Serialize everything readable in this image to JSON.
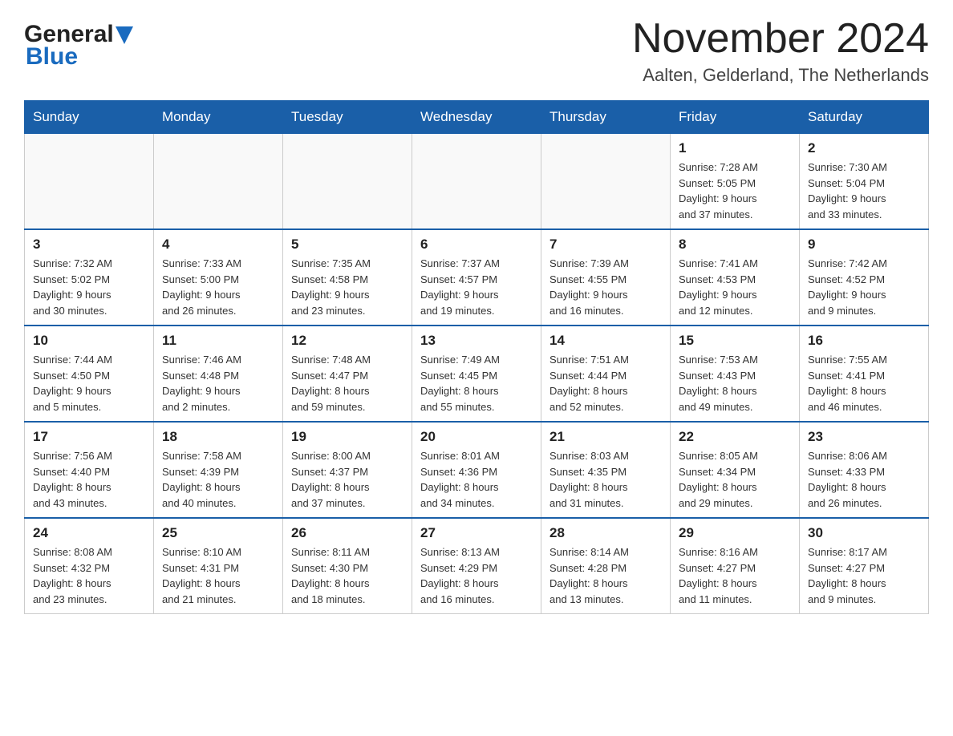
{
  "logo": {
    "part1": "General",
    "part2": "Blue"
  },
  "title": "November 2024",
  "subtitle": "Aalten, Gelderland, The Netherlands",
  "days_of_week": [
    "Sunday",
    "Monday",
    "Tuesday",
    "Wednesday",
    "Thursday",
    "Friday",
    "Saturday"
  ],
  "weeks": [
    [
      {
        "day": "",
        "info": ""
      },
      {
        "day": "",
        "info": ""
      },
      {
        "day": "",
        "info": ""
      },
      {
        "day": "",
        "info": ""
      },
      {
        "day": "",
        "info": ""
      },
      {
        "day": "1",
        "info": "Sunrise: 7:28 AM\nSunset: 5:05 PM\nDaylight: 9 hours\nand 37 minutes."
      },
      {
        "day": "2",
        "info": "Sunrise: 7:30 AM\nSunset: 5:04 PM\nDaylight: 9 hours\nand 33 minutes."
      }
    ],
    [
      {
        "day": "3",
        "info": "Sunrise: 7:32 AM\nSunset: 5:02 PM\nDaylight: 9 hours\nand 30 minutes."
      },
      {
        "day": "4",
        "info": "Sunrise: 7:33 AM\nSunset: 5:00 PM\nDaylight: 9 hours\nand 26 minutes."
      },
      {
        "day": "5",
        "info": "Sunrise: 7:35 AM\nSunset: 4:58 PM\nDaylight: 9 hours\nand 23 minutes."
      },
      {
        "day": "6",
        "info": "Sunrise: 7:37 AM\nSunset: 4:57 PM\nDaylight: 9 hours\nand 19 minutes."
      },
      {
        "day": "7",
        "info": "Sunrise: 7:39 AM\nSunset: 4:55 PM\nDaylight: 9 hours\nand 16 minutes."
      },
      {
        "day": "8",
        "info": "Sunrise: 7:41 AM\nSunset: 4:53 PM\nDaylight: 9 hours\nand 12 minutes."
      },
      {
        "day": "9",
        "info": "Sunrise: 7:42 AM\nSunset: 4:52 PM\nDaylight: 9 hours\nand 9 minutes."
      }
    ],
    [
      {
        "day": "10",
        "info": "Sunrise: 7:44 AM\nSunset: 4:50 PM\nDaylight: 9 hours\nand 5 minutes."
      },
      {
        "day": "11",
        "info": "Sunrise: 7:46 AM\nSunset: 4:48 PM\nDaylight: 9 hours\nand 2 minutes."
      },
      {
        "day": "12",
        "info": "Sunrise: 7:48 AM\nSunset: 4:47 PM\nDaylight: 8 hours\nand 59 minutes."
      },
      {
        "day": "13",
        "info": "Sunrise: 7:49 AM\nSunset: 4:45 PM\nDaylight: 8 hours\nand 55 minutes."
      },
      {
        "day": "14",
        "info": "Sunrise: 7:51 AM\nSunset: 4:44 PM\nDaylight: 8 hours\nand 52 minutes."
      },
      {
        "day": "15",
        "info": "Sunrise: 7:53 AM\nSunset: 4:43 PM\nDaylight: 8 hours\nand 49 minutes."
      },
      {
        "day": "16",
        "info": "Sunrise: 7:55 AM\nSunset: 4:41 PM\nDaylight: 8 hours\nand 46 minutes."
      }
    ],
    [
      {
        "day": "17",
        "info": "Sunrise: 7:56 AM\nSunset: 4:40 PM\nDaylight: 8 hours\nand 43 minutes."
      },
      {
        "day": "18",
        "info": "Sunrise: 7:58 AM\nSunset: 4:39 PM\nDaylight: 8 hours\nand 40 minutes."
      },
      {
        "day": "19",
        "info": "Sunrise: 8:00 AM\nSunset: 4:37 PM\nDaylight: 8 hours\nand 37 minutes."
      },
      {
        "day": "20",
        "info": "Sunrise: 8:01 AM\nSunset: 4:36 PM\nDaylight: 8 hours\nand 34 minutes."
      },
      {
        "day": "21",
        "info": "Sunrise: 8:03 AM\nSunset: 4:35 PM\nDaylight: 8 hours\nand 31 minutes."
      },
      {
        "day": "22",
        "info": "Sunrise: 8:05 AM\nSunset: 4:34 PM\nDaylight: 8 hours\nand 29 minutes."
      },
      {
        "day": "23",
        "info": "Sunrise: 8:06 AM\nSunset: 4:33 PM\nDaylight: 8 hours\nand 26 minutes."
      }
    ],
    [
      {
        "day": "24",
        "info": "Sunrise: 8:08 AM\nSunset: 4:32 PM\nDaylight: 8 hours\nand 23 minutes."
      },
      {
        "day": "25",
        "info": "Sunrise: 8:10 AM\nSunset: 4:31 PM\nDaylight: 8 hours\nand 21 minutes."
      },
      {
        "day": "26",
        "info": "Sunrise: 8:11 AM\nSunset: 4:30 PM\nDaylight: 8 hours\nand 18 minutes."
      },
      {
        "day": "27",
        "info": "Sunrise: 8:13 AM\nSunset: 4:29 PM\nDaylight: 8 hours\nand 16 minutes."
      },
      {
        "day": "28",
        "info": "Sunrise: 8:14 AM\nSunset: 4:28 PM\nDaylight: 8 hours\nand 13 minutes."
      },
      {
        "day": "29",
        "info": "Sunrise: 8:16 AM\nSunset: 4:27 PM\nDaylight: 8 hours\nand 11 minutes."
      },
      {
        "day": "30",
        "info": "Sunrise: 8:17 AM\nSunset: 4:27 PM\nDaylight: 8 hours\nand 9 minutes."
      }
    ]
  ]
}
